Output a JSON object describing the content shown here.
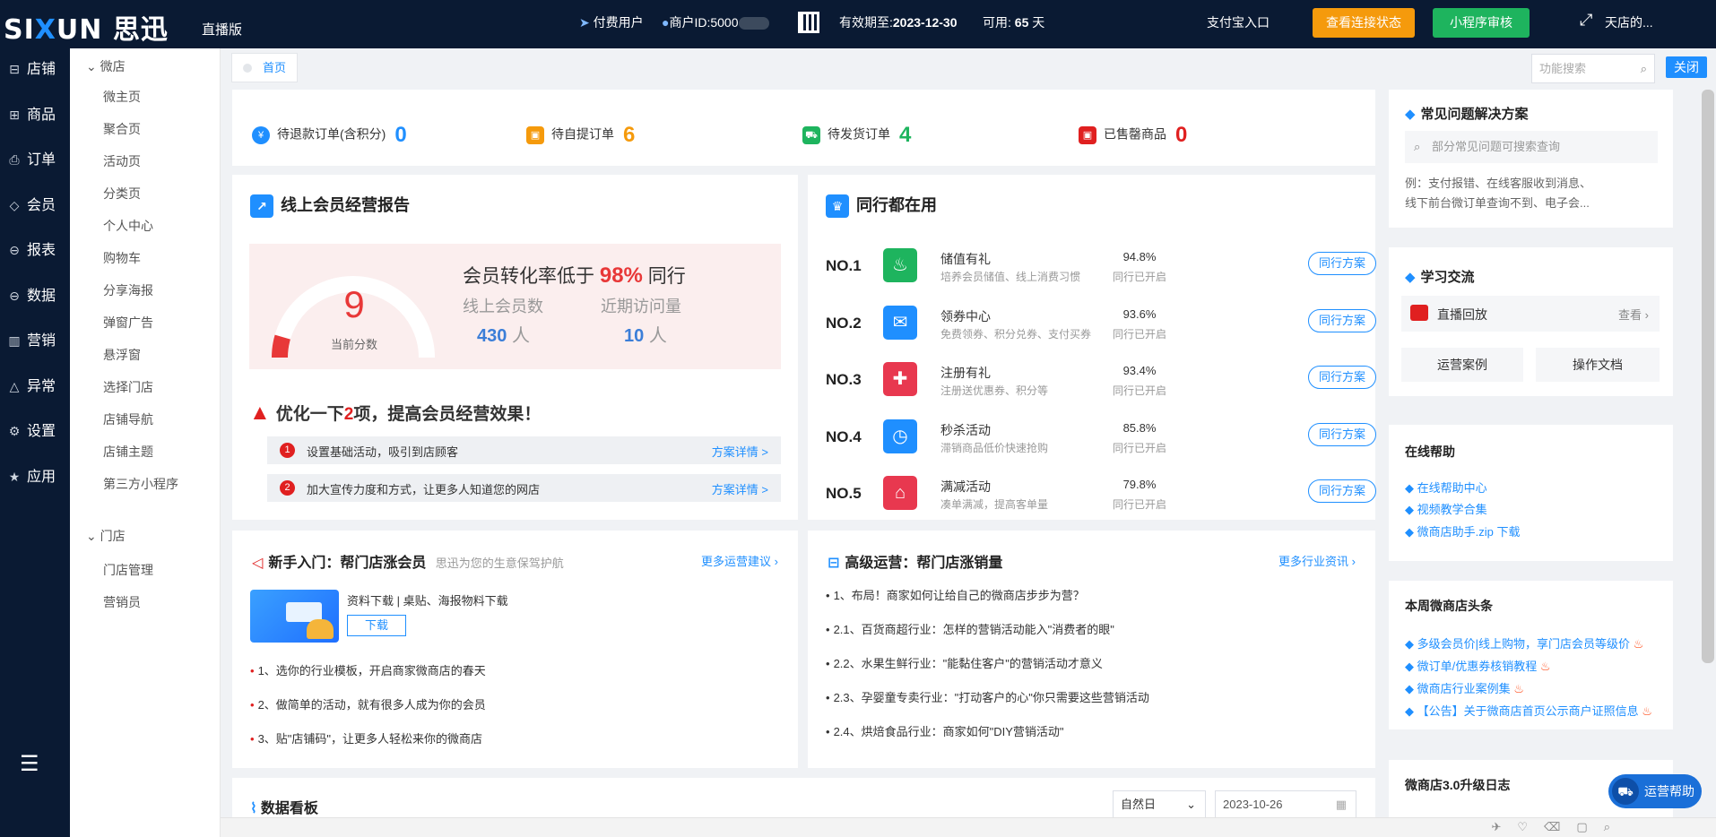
{
  "topbar": {
    "logo_left": "SI",
    "logo_x": "X",
    "logo_right": "UN",
    "logo_cn": "思迅",
    "edition": "直播版",
    "paid_user": "付费用户",
    "merchant_id": "商户ID:5000",
    "expire_label": "有效期至:",
    "expire_date": "2023-12-30",
    "available_label": "可用:",
    "available_days": "65",
    "days_unit": "天",
    "alipay_entry": "支付宝入口",
    "check_connection": "查看连接状态",
    "miniapp_review": "小程序审核",
    "store_name": "天店的..."
  },
  "sidebar": {
    "items": [
      {
        "label": "店铺",
        "icon": "store-icon"
      },
      {
        "label": "商品",
        "icon": "gift-icon"
      },
      {
        "label": "订单",
        "icon": "order-icon"
      },
      {
        "label": "会员",
        "icon": "member-icon"
      },
      {
        "label": "报表",
        "icon": "report-icon"
      },
      {
        "label": "数据",
        "icon": "data-icon"
      },
      {
        "label": "营销",
        "icon": "marketing-icon"
      },
      {
        "label": "异常",
        "icon": "warning-icon"
      },
      {
        "label": "设置",
        "icon": "gear-icon"
      },
      {
        "label": "应用",
        "icon": "star-icon"
      }
    ]
  },
  "subnav": {
    "group1": "微店",
    "group1_items": [
      "微主页",
      "聚合页",
      "活动页",
      "分类页",
      "个人中心",
      "购物车",
      "分享海报",
      "弹窗广告",
      "悬浮窗",
      "选择门店",
      "店铺导航",
      "店铺主题",
      "第三方小程序"
    ],
    "group2": "门店",
    "group2_items": [
      "门店管理",
      "营销员"
    ]
  },
  "tabs": {
    "home": "首页"
  },
  "search": {
    "placeholder": "功能搜索"
  },
  "close_label": "关闭",
  "stats": [
    {
      "label": "待退款订单(含积分)",
      "value": "0",
      "color": "#1f8fff"
    },
    {
      "label": "待自提订单",
      "value": "6",
      "color": "#f59a0c"
    },
    {
      "label": "待发货订单",
      "value": "4",
      "color": "#1eb45e"
    },
    {
      "label": "已售罄商品",
      "value": "0",
      "color": "#e02020"
    }
  ],
  "report": {
    "title": "线上会员经营报告",
    "score": "9",
    "score_label": "当前分数",
    "score_fraction": 0.09,
    "rate_prefix": "会员转化率低于",
    "rate_value": "98%",
    "rate_suffix": "同行",
    "members_label": "线上会员数",
    "members_value": "430",
    "members_unit": "人",
    "visits_label": "近期访问量",
    "visits_value": "10",
    "visits_unit": "人",
    "optimize_prefix": "优化一下",
    "optimize_count": "2",
    "optimize_suffix": "项，提高会员经营效果！",
    "tasks": [
      {
        "no": "1",
        "text": "设置基础活动，吸引到店顾客",
        "link": "方案详情 >"
      },
      {
        "no": "2",
        "text": "加大宣传力度和方式，让更多人知道您的网店",
        "link": "方案详情 >"
      }
    ]
  },
  "peers": {
    "title": "同行都在用",
    "items": [
      {
        "no": "NO.1",
        "name": "储值有礼",
        "desc": "培养会员储值、线上消费习惯",
        "pct": "94.8%",
        "sub": "同行已开启",
        "btn": "同行方案",
        "color": "#1eb45e",
        "glyph": "♨"
      },
      {
        "no": "NO.2",
        "name": "领券中心",
        "desc": "免费领券、积分兑券、支付买券",
        "pct": "93.6%",
        "sub": "同行已开启",
        "btn": "同行方案",
        "color": "#1f8fff",
        "glyph": "✉"
      },
      {
        "no": "NO.3",
        "name": "注册有礼",
        "desc": "注册送优惠券、积分等",
        "pct": "93.4%",
        "sub": "同行已开启",
        "btn": "同行方案",
        "color": "#e8384f",
        "glyph": "✚"
      },
      {
        "no": "NO.4",
        "name": "秒杀活动",
        "desc": "滞销商品低价快速抢购",
        "pct": "85.8%",
        "sub": "同行已开启",
        "btn": "同行方案",
        "color": "#1f8fff",
        "glyph": "◷"
      },
      {
        "no": "NO.5",
        "name": "满减活动",
        "desc": "凑单满减，提高客单量",
        "pct": "79.8%",
        "sub": "同行已开启",
        "btn": "同行方案",
        "color": "#e8384f",
        "glyph": "⌂"
      }
    ]
  },
  "newbie": {
    "title": "新手入门：帮门店涨会员",
    "subtitle": "思迅为您的生意保驾护航",
    "more": "更多运营建议",
    "resource_text": "资料下载 | 桌贴、海报物料下载",
    "download": "下载",
    "items": [
      "1、选你的行业模板，开启商家微商店的春天",
      "2、做简单的活动，就有很多人成为你的会员",
      "3、贴\"店铺码\"，让更多人轻松来你的微商店"
    ]
  },
  "advanced": {
    "title": "高级运营：帮门店涨销量",
    "more": "更多行业资讯",
    "items": [
      "1、布局！商家如何让给自己的微商店步步为营？",
      "2.1、百货商超行业：怎样的营销活动能入\"消费者的眼\"",
      "2.2、水果生鲜行业：\"能黏住客户\"的营销活动才意义",
      "2.3、孕婴童专卖行业：\"打动客户的心\"你只需要这些营销活动",
      "2.4、烘焙食品行业：商家如何\"DIY营销活动\""
    ]
  },
  "dashboard": {
    "title": "数据看板",
    "period": "自然日",
    "date": "2023-10-26"
  },
  "faq": {
    "title": "常见问题解决方案",
    "search_placeholder": "部分常见问题可搜索查询",
    "example_line1": "例：支付报错、在线客服收到消息、",
    "example_line2": "线下前台微订单查询不到、电子会..."
  },
  "learning": {
    "title": "学习交流",
    "live_replay": "直播回放",
    "view": "查看",
    "cases": "运营案例",
    "docs": "操作文档"
  },
  "online_help": {
    "title": "在线帮助",
    "links": [
      "在线帮助中心",
      "视频教学合集",
      "微商店助手.zip 下载"
    ]
  },
  "headlines": {
    "title": "本周微商店头条",
    "links": [
      "多级会员价|线上购物，享门店会员等级价",
      "微订单/优惠券核销教程",
      "微商店行业案例集",
      "【公告】关于微商店首页公示商户证照信息"
    ]
  },
  "changelog": {
    "title": "微商店3.0升级日志"
  },
  "help_fab": "运营帮助"
}
